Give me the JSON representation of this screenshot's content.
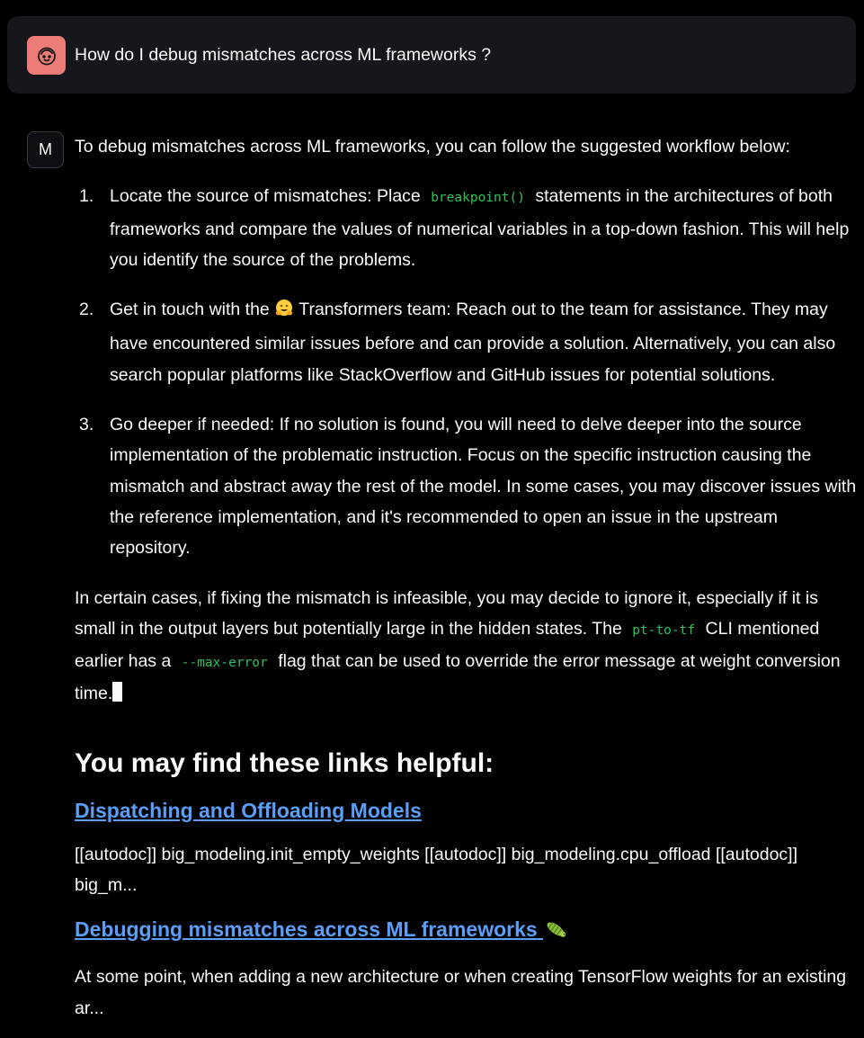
{
  "user": {
    "question": "How do I debug mismatches across ML frameworks ?"
  },
  "bot": {
    "avatar_letter": "M",
    "intro": "To debug mismatches across ML frameworks, you can follow the suggested workflow below:",
    "steps": [
      {
        "num": "1.",
        "text_before": "Locate the source of mismatches: Place",
        "code": "breakpoint()",
        "text_after": "statements in the architectures of both frameworks and compare the values of numerical variables in a top-down fashion. This will help you identify the source of the problems."
      },
      {
        "num": "2.",
        "text_before": "Get in touch with the",
        "emoji_icon": "hugging-face-emoji",
        "text_after": "Transformers team: Reach out to the team for assistance. They may have encountered similar issues before and can provide a solution. Alternatively, you can also search popular platforms like StackOverflow and GitHub issues for potential solutions."
      },
      {
        "num": "3.",
        "text": "Go deeper if needed: If no solution is found, you will need to delve deeper into the source implementation of the problematic instruction. Focus on the specific instruction causing the mismatch and abstract away the rest of the model. In some cases, you may discover issues with the reference implementation, and it's recommended to open an issue in the upstream repository."
      }
    ],
    "closing": {
      "part1": "In certain cases, if fixing the mismatch is infeasible, you may decide to ignore it, especially if it is small in the output layers but potentially large in the hidden states. The",
      "code1": "pt-to-tf",
      "part2": "CLI mentioned earlier has a",
      "code2": "--max-error",
      "part3": "flag that can be used to override the error message at weight conversion time."
    }
  },
  "links": {
    "heading": "You may find these links helpful:",
    "items": [
      {
        "title": "Dispatching and Offloading Models",
        "snippet": "[[autodoc]] big_modeling.init_empty_weights [[autodoc]] big_modeling.cpu_offload [[autodoc]] big_m..."
      },
      {
        "title": "Debugging mismatches across ML frameworks",
        "title_icon": "bug-emoji",
        "snippet": "At some point, when adding a new architecture or when creating TensorFlow weights for an existing ar..."
      }
    ]
  },
  "colors": {
    "background": "#000000",
    "user_bubble": "#16171c",
    "user_avatar": "#ee7c76",
    "code_text": "#2fc15c",
    "link": "#5a9ef8"
  }
}
